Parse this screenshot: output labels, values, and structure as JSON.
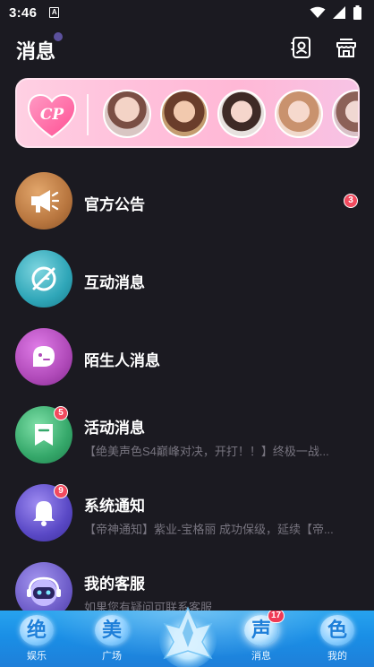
{
  "status_bar": {
    "time": "3:46",
    "sim_label": "A"
  },
  "header": {
    "title": "消息"
  },
  "banner": {
    "logo_text": "CP"
  },
  "conversations": [
    {
      "name": "官方公告",
      "preview": "",
      "badge": "3",
      "color": "#b8763f"
    },
    {
      "name": "互动消息",
      "preview": "",
      "badge": "",
      "color": "#2fa6b8"
    },
    {
      "name": "陌生人消息",
      "preview": "",
      "badge": "",
      "color": "#b04ab9"
    },
    {
      "name": "活动消息",
      "preview": "【绝美声色S4巅峰对决，开打！！】终极一战...",
      "badge": "5",
      "color": "#35a86a"
    },
    {
      "name": "系统通知",
      "preview": "【帝神通知】紫业-宝格丽 成功保级，延续【帝...",
      "badge": "9",
      "color": "#5a49c6"
    },
    {
      "name": "我的客服",
      "preview": "如果您有疑问可联系客服",
      "badge": "",
      "color": "#6e5dc9"
    }
  ],
  "bottom_nav": [
    {
      "glyph": "绝",
      "label": "娱乐"
    },
    {
      "glyph": "美",
      "label": "广场"
    },
    {
      "glyph": "声",
      "label": "消息",
      "badge": "17"
    },
    {
      "glyph": "色",
      "label": "我的"
    }
  ]
}
